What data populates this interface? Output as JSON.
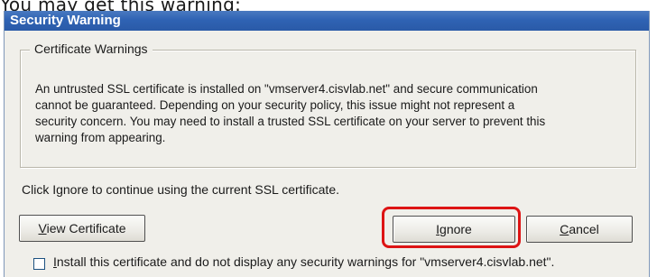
{
  "caption": "You may get this warning:",
  "window": {
    "title": "Security Warning"
  },
  "certificate_group": {
    "label": "Certificate Warnings",
    "message_lines": [
      "An untrusted SSL certificate is installed on \"vmserver4.cisvlab.net\" and secure communication",
      "cannot be guaranteed.  Depending on your security policy, this issue might not represent a",
      "security concern.  You may need to install a trusted SSL certificate on your server to prevent this",
      "warning from appearing."
    ]
  },
  "info": "Click Ignore to continue using the current SSL certificate.",
  "buttons": {
    "view_certificate": {
      "mnemonic": "V",
      "rest": "iew Certificate"
    },
    "ignore": {
      "mnemonic": "I",
      "rest": "gnore"
    },
    "cancel": {
      "mnemonic": "C",
      "rest": "ancel"
    }
  },
  "checkbox": {
    "checked": false,
    "mnemonic": "I",
    "rest": "nstall this certificate and do not display any security warnings for \"vmserver4.cisvlab.net\"."
  },
  "colors": {
    "title_bar": "#2f63b4",
    "dialog_background": "#f0efea",
    "highlight": "#dd1414"
  }
}
